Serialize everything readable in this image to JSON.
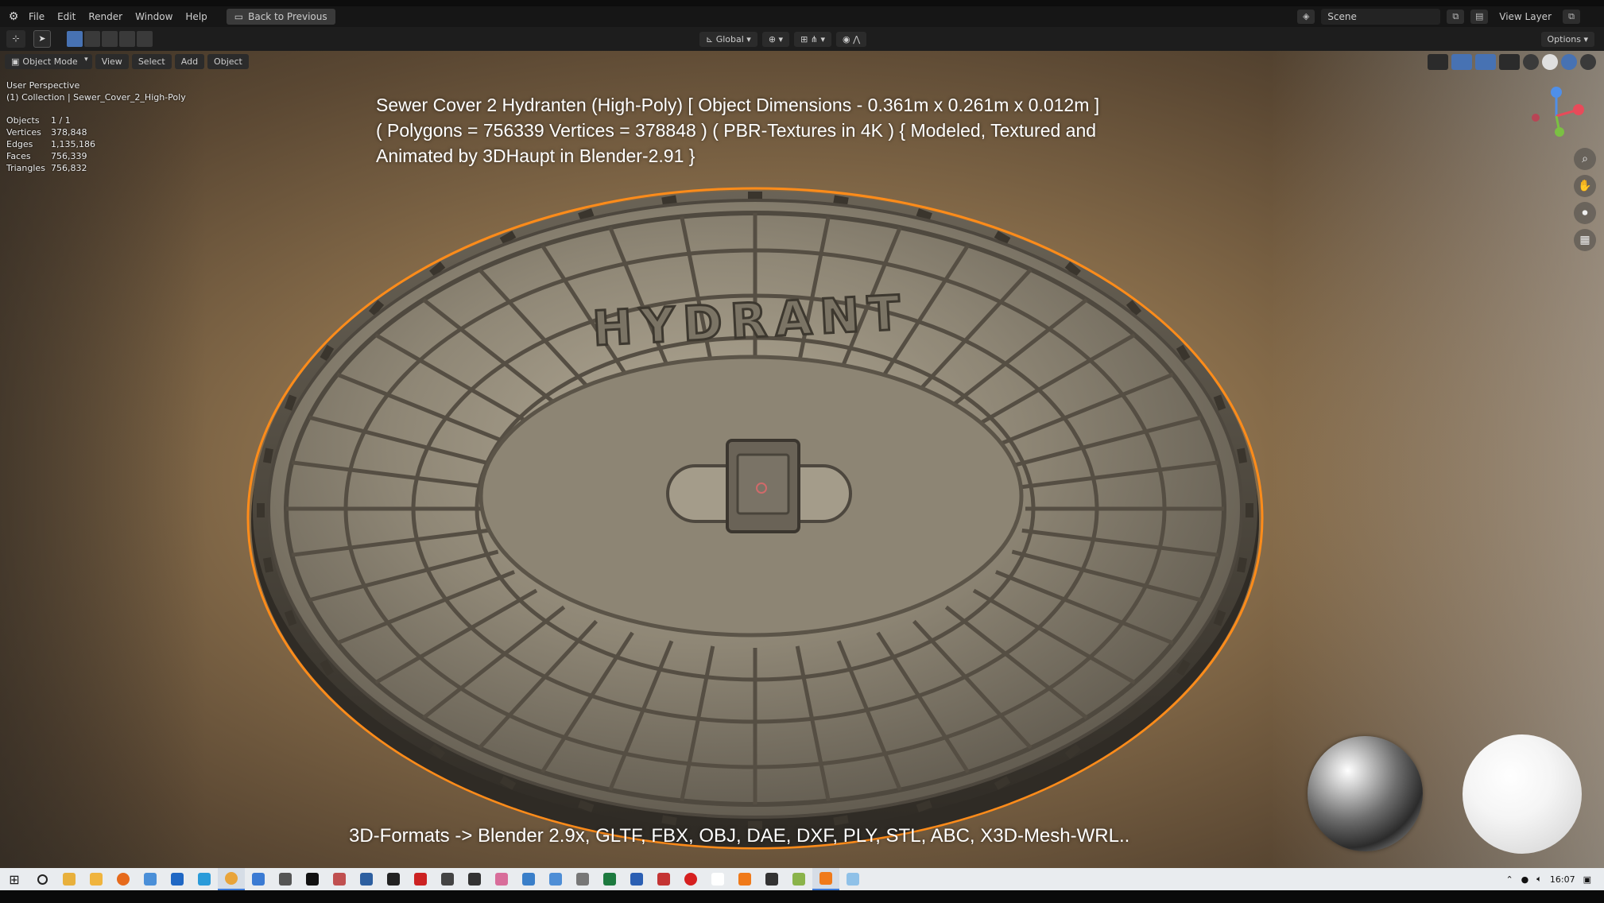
{
  "topbar": {
    "menu": [
      "File",
      "Edit",
      "Render",
      "Window",
      "Help"
    ],
    "back_button": "Back to Previous",
    "scene": "Scene",
    "view_layer": "View Layer"
  },
  "header2": {
    "orientation": "Global",
    "options": "Options"
  },
  "viewport_header": {
    "mode": "Object Mode",
    "view": "View",
    "select": "Select",
    "add": "Add",
    "object": "Object"
  },
  "stats": {
    "perspective": "User Perspective",
    "collection": "(1) Collection | Sewer_Cover_2_High-Poly",
    "rows": [
      {
        "label": "Objects",
        "value": "1 / 1"
      },
      {
        "label": "Vertices",
        "value": "378,848"
      },
      {
        "label": "Edges",
        "value": "1,135,186"
      },
      {
        "label": "Faces",
        "value": "756,339"
      },
      {
        "label": "Triangles",
        "value": "756,832"
      }
    ]
  },
  "overlay": {
    "title_line1": "Sewer Cover 2 Hydranten (High-Poly) [ Object Dimensions -  0.361m x 0.261m x 0.012m ]",
    "title_line2": "( Polygons = 756339 Vertices = 378848 ) ( PBR-Textures in 4K ) { Modeled, Textured and",
    "title_line3": "Animated by 3DHaupt in Blender-2.91 }",
    "cover_text": "HYDRANT",
    "formats": "3D-Formats -> Blender 2.9x, GLTF, FBX, OBJ, DAE, DXF, PLY, STL, ABC, X3D-Mesh-WRL.."
  },
  "taskbar": {
    "time": "16:07",
    "icons": [
      "search-icon",
      "file-explorer-icon",
      "folder-icon",
      "firefox-icon",
      "notepad-icon",
      "outlook-icon",
      "skype-icon",
      "chrome-icon",
      "store-icon",
      "app-icon",
      "unity-icon",
      "gimp-icon",
      "inkscape-icon",
      "unity-hub-icon",
      "acrobat-icon",
      "app-icon-2",
      "obs-icon",
      "paint-icon",
      "calculator-icon",
      "app-icon-3",
      "app-icon-4",
      "excel-icon",
      "word-icon",
      "app-icon-5",
      "opera-icon",
      "notepad-icon-2",
      "blender-icon",
      "terminal-icon",
      "app-icon-6",
      "blender-active-icon",
      "image-viewer-icon"
    ],
    "colors": [
      "#2b6cd6",
      "#e8b03c",
      "#f0b43e",
      "#e66a1c",
      "#4a8fd8",
      "#1f67c4",
      "#2a9bd9",
      "#e9a43a",
      "#3b7bd3",
      "#555555",
      "#111111",
      "#c05050",
      "#2d5fa0",
      "#222222",
      "#cc2222",
      "#444444",
      "#333333",
      "#d86d9a",
      "#3a7fc9",
      "#4e8ed6",
      "#777777",
      "#1d7a3f",
      "#2b5fb3",
      "#c43434",
      "#d62020",
      "#ffffff",
      "#f07a1a",
      "#333333",
      "#8ab34a",
      "#f07a1a",
      "#8fc1e8"
    ]
  },
  "colors": {
    "selection_outline": "#ff8c1a",
    "active_blue": "#4772b3"
  }
}
